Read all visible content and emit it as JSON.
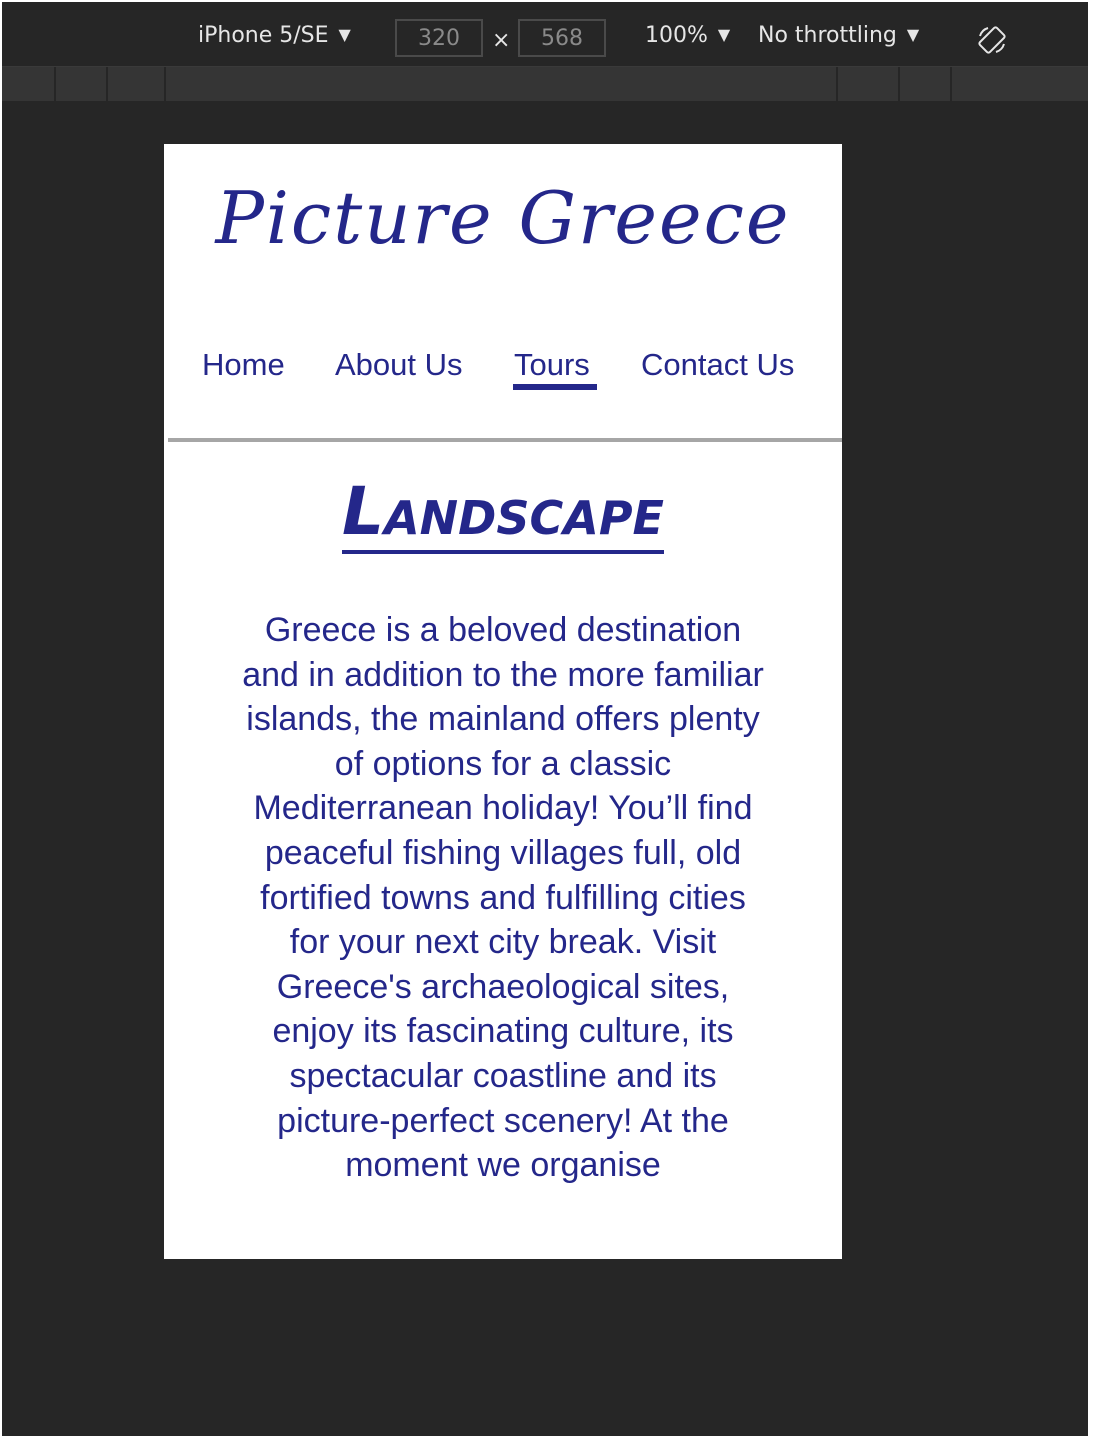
{
  "toolbar": {
    "device": "iPhone 5/SE",
    "width": "320",
    "height": "568",
    "times": "×",
    "zoom": "100%",
    "throttling": "No throttling",
    "caret": "▼"
  },
  "site": {
    "logo": "Picture Greece",
    "nav": [
      {
        "label": "Home"
      },
      {
        "label": "About Us"
      },
      {
        "label": "Tours",
        "active": true
      },
      {
        "label": "Contact Us"
      }
    ],
    "heading": "Landscape",
    "intro": "Greece is a beloved destination and in addition to the more familiar islands, the mainland offers plenty of options for a classic Mediterranean holiday! You’ll find peaceful fishing villages full, old fortified towns and fulfilling cities for your next city break. Visit Greece's archaeological sites, enjoy its fascinating culture, its spectacular coastline and its picture-perfect scenery! At the moment we organise"
  },
  "colors": {
    "brand": "#24278a",
    "devtools_bg": "#262626",
    "divider": "#a6a6a6"
  },
  "icons": {
    "rotate": "rotate-icon",
    "dropdown": "chevron-down-icon"
  }
}
